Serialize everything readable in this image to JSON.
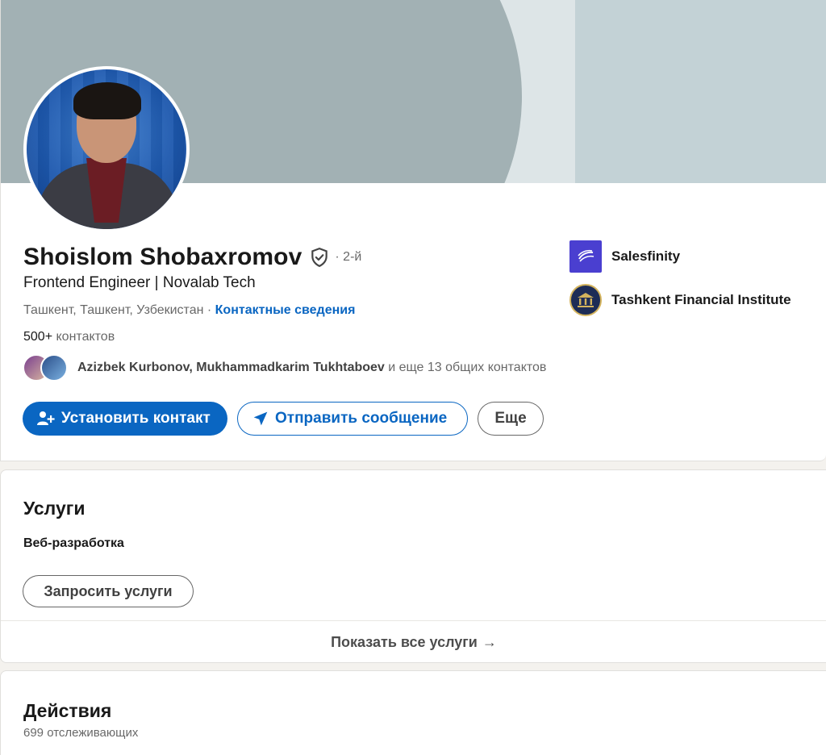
{
  "profile": {
    "name": "Shoislom Shobaxromov",
    "degree": "· 2-й",
    "headline": "Frontend Engineer | Novalab Tech",
    "location": "Ташкент, Ташкент, Узбекистан ·",
    "contact_info_link": "Контактные сведения",
    "connections_count": "500+",
    "connections_label": "контактов",
    "mutual": {
      "names": "Azizbek Kurbonov, Mukhammadkarim Tukhtaboev",
      "suffix": "и еще 13 общих контактов"
    },
    "buttons": {
      "connect": "Установить контакт",
      "message": "Отправить сообщение",
      "more": "Еще"
    },
    "organizations": [
      {
        "name": "Salesfinity",
        "logo": "salesfinity-logo"
      },
      {
        "name": "Tashkent Financial Institute",
        "logo": "tfi-logo"
      }
    ]
  },
  "services": {
    "title": "Услуги",
    "item": "Веб-разработка",
    "request_button": "Запросить услуги",
    "show_all": "Показать все услуги",
    "show_all_arrow": "→"
  },
  "activity": {
    "title": "Действия",
    "followers": "699 отслеживающих"
  },
  "colors": {
    "accent": "#0a66c2",
    "background": "#f4f2ee",
    "cover_dark": "#a2b1b4",
    "cover_light": "#c3d2d6"
  }
}
